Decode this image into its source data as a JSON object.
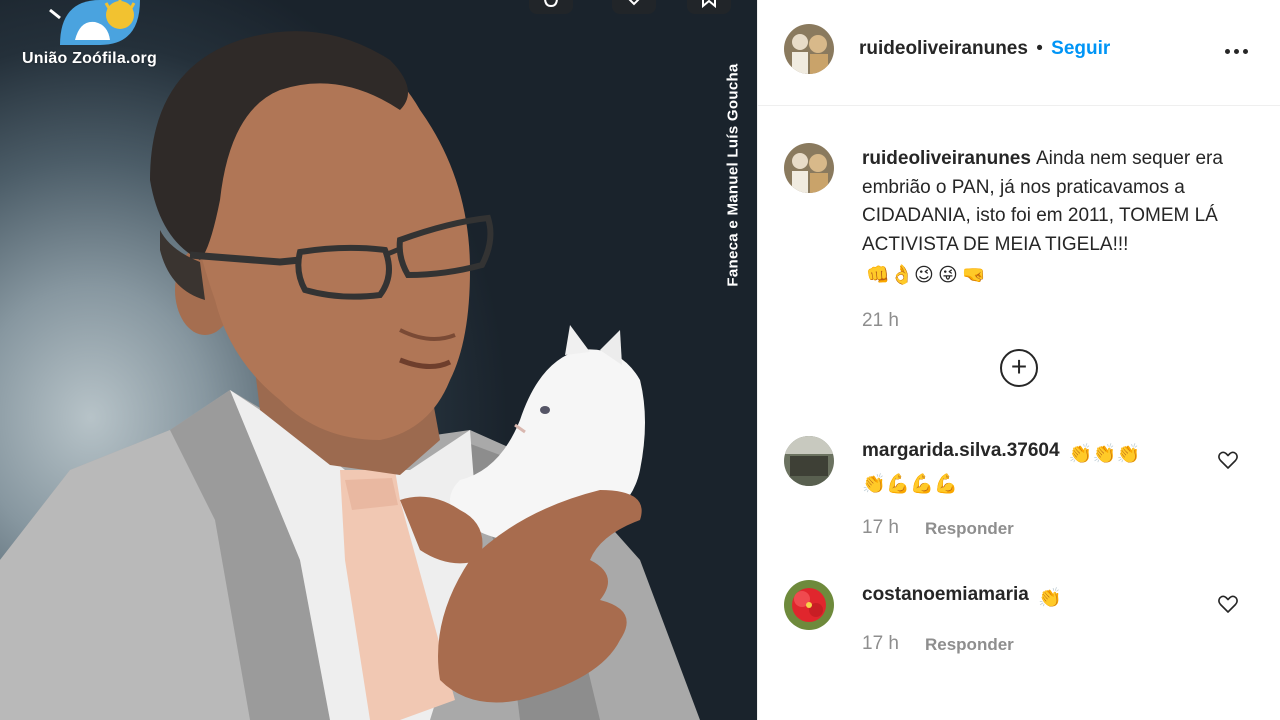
{
  "media": {
    "logo_text": "União Zoófila.org",
    "watermark": "Faneca e Manuel Luís Goucha",
    "icons": [
      "comment-icon",
      "share-icon",
      "save-icon"
    ]
  },
  "post": {
    "author": "ruideoliveiranunes",
    "separator": "•",
    "follow_label": "Seguir",
    "more_icon": "more-options-icon"
  },
  "caption": {
    "username": "ruideoliveiranunes",
    "text": "Ainda nem sequer era embrião o PAN, já nos praticavamos a CIDADANIA, isto foi em 2011, TOMEM LÁ ACTIVISTA DE MEIA TIGELA!!!",
    "emojis": [
      "👊",
      "👌",
      "😉",
      "😜",
      "🤜"
    ],
    "time": "21 h"
  },
  "load_more_icon": "plus-circle-icon",
  "comments": [
    {
      "username": "margarida.silva.37604",
      "emojis_line1": [
        "👏",
        "👏",
        "👏"
      ],
      "emojis_line2": [
        "👏",
        "💪",
        "💪",
        "💪"
      ],
      "time": "17 h",
      "reply_label": "Responder"
    },
    {
      "username": "costanoemiamaria",
      "emojis_line1": [
        "👏"
      ],
      "time": "17 h",
      "reply_label": "Responder"
    }
  ],
  "colors": {
    "accent": "#0095f6",
    "text": "#262626",
    "muted": "#8e8e8e",
    "divider": "#efefef"
  }
}
